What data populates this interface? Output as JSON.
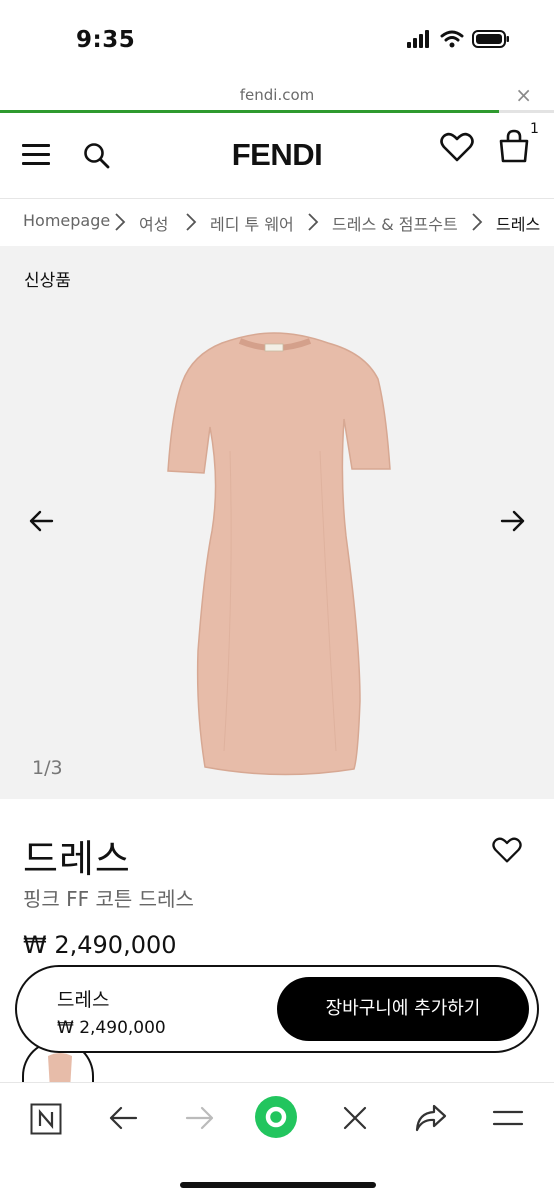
{
  "status": {
    "time": "9:35"
  },
  "browser": {
    "url": "fendi.com",
    "close": "×",
    "load_progress": 0.9
  },
  "header": {
    "logo": "FENDI",
    "bag_count": "1"
  },
  "breadcrumb": [
    "Homepage",
    "여성",
    "레디 투 웨어",
    "드레스 & 점프수트",
    "드레스"
  ],
  "gallery": {
    "tag": "신상품",
    "counter": "1/3"
  },
  "product": {
    "title": "드레스",
    "subtitle": "핑크 FF 코튼 드레스",
    "price": "₩ 2,490,000"
  },
  "sticky": {
    "name": "드레스",
    "price": "₩ 2,490,000",
    "cta": "장바구니에 추가하기"
  },
  "colors": {
    "accent": "#2f9a2f",
    "dress": "#e7bca9",
    "cta_bg": "#000000",
    "nav_green": "#22c55e"
  }
}
